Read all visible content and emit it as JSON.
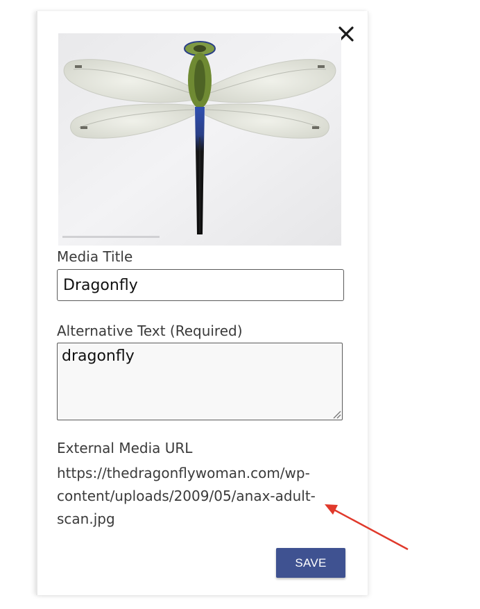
{
  "modal": {
    "close_icon": "close-icon",
    "image": {
      "subject": "dragonfly",
      "colors": {
        "background": "#efeff1",
        "wing": "#e4e6df",
        "wing_vein": "#c9cbc2",
        "thorax": "#6f8a33",
        "abdomen_blue": "#2f4fb0",
        "abdomen_dark": "#121212"
      }
    },
    "title": {
      "label": "Media Title",
      "value": "Dragonfly"
    },
    "alt_text": {
      "label": "Alternative Text (Required)",
      "value": "dragonfly"
    },
    "external_url": {
      "label": "External Media URL",
      "value": "https://thedragonflywoman.com/wp-content/uploads/2009/05/anax-adult-scan.jpg"
    },
    "save_label": "SAVE"
  },
  "annotation": {
    "type": "arrow",
    "color": "#e0392b"
  },
  "colors": {
    "accent": "#3f5291",
    "label_text": "#3a3a3a",
    "input_border": "#5a5a5a"
  }
}
